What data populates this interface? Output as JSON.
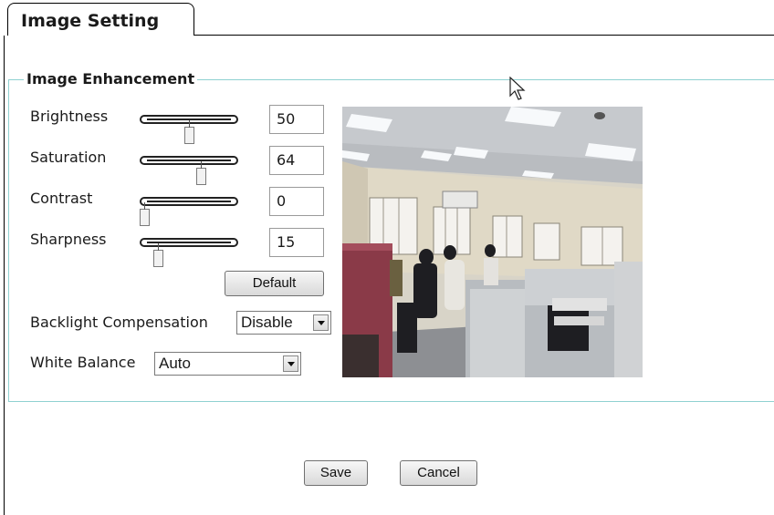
{
  "tab": {
    "title": "Image Setting"
  },
  "section": {
    "legend": "Image Enhancement"
  },
  "sliders": [
    {
      "label": "Brightness",
      "value": "50",
      "level": 0.5
    },
    {
      "label": "Saturation",
      "value": "64",
      "level": 0.64
    },
    {
      "label": "Contrast",
      "value": "0",
      "level": 0.0
    },
    {
      "label": "Sharpness",
      "value": "15",
      "level": 0.15
    }
  ],
  "default_label": "Default",
  "backlight": {
    "label": "Backlight Compensation",
    "selected": "Disable"
  },
  "white_balance": {
    "label": "White Balance",
    "selected": "Auto"
  },
  "footer": {
    "save_label": "Save",
    "cancel_label": "Cancel"
  },
  "icons": {
    "cursor": "mouse-pointer-icon",
    "dropdown": "chevron-down-icon"
  },
  "colors": {
    "fieldset_border": "#8fd1d1"
  }
}
